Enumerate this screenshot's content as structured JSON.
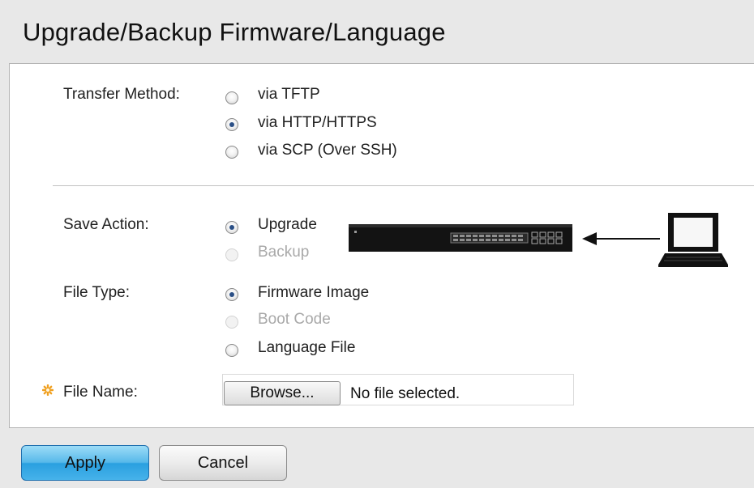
{
  "page": {
    "title": "Upgrade/Backup Firmware/Language"
  },
  "transfer_method": {
    "label": "Transfer Method:",
    "options": [
      {
        "label": "via TFTP",
        "checked": false,
        "disabled": false
      },
      {
        "label": "via HTTP/HTTPS",
        "checked": true,
        "disabled": false
      },
      {
        "label": "via SCP (Over SSH)",
        "checked": false,
        "disabled": false
      }
    ]
  },
  "save_action": {
    "label": "Save Action:",
    "options": [
      {
        "label": "Upgrade",
        "checked": true,
        "disabled": false
      },
      {
        "label": "Backup",
        "checked": false,
        "disabled": true
      }
    ]
  },
  "file_type": {
    "label": "File Type:",
    "options": [
      {
        "label": "Firmware Image",
        "checked": true,
        "disabled": false
      },
      {
        "label": "Boot Code",
        "checked": false,
        "disabled": true
      },
      {
        "label": "Language File",
        "checked": false,
        "disabled": false
      }
    ]
  },
  "file_name": {
    "label": "File Name:",
    "required": true,
    "browse_label": "Browse...",
    "status": "No file selected."
  },
  "buttons": {
    "apply": "Apply",
    "cancel": "Cancel"
  },
  "icons": {
    "required": "required-star-icon",
    "switch": "network-switch-icon",
    "arrow": "left-arrow-icon",
    "computer": "laptop-icon"
  },
  "colors": {
    "apply_button": "#3aaee6",
    "required_star": "#f0a020",
    "radio_checked": "#2a4f86",
    "disabled_text": "#a9a9a9"
  }
}
